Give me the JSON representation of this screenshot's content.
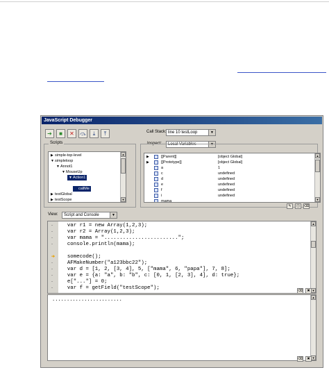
{
  "window": {
    "title": "JavaScript Debugger"
  },
  "toolbar": {
    "buttons": [
      {
        "name": "resume-button",
        "icon": "green-arrow-icon",
        "glyph": "➔",
        "color": "#2d8a2d"
      },
      {
        "name": "pause-button",
        "icon": "pause-icon",
        "glyph": "■",
        "color": "#2d8a2d"
      },
      {
        "name": "quit-button",
        "icon": "red-x-icon",
        "glyph": "✕",
        "color": "#c41a1a"
      },
      {
        "name": "step-over-button",
        "icon": "step-over-icon",
        "glyph": "⤼",
        "color": "#1e3a7a"
      },
      {
        "name": "step-into-button",
        "icon": "step-into-icon",
        "glyph": "⤓",
        "color": "#1e3a7a"
      },
      {
        "name": "step-out-button",
        "icon": "step-out-icon",
        "glyph": "⤒",
        "color": "#1e3a7a"
      }
    ]
  },
  "callstack": {
    "label": "Call Stack:",
    "value": "line 10 testLoop"
  },
  "inspect": {
    "label": "Inspect:",
    "value": "Local Variables"
  },
  "scripts": {
    "label": "Scripts",
    "tree": [
      {
        "label": "simple-top-level",
        "indent": 0,
        "expander": "▶"
      },
      {
        "label": "simpleloop",
        "indent": 0,
        "expander": "▼"
      },
      {
        "label": "Annot1",
        "indent": 1,
        "expander": "▼"
      },
      {
        "label": "MouseUp",
        "indent": 2,
        "expander": "▼"
      },
      {
        "label": "Action1",
        "indent": 3,
        "expander": "▼",
        "selected": true
      },
      {
        "label": "",
        "indent": 4,
        "expander": ""
      },
      {
        "label": "callMe",
        "indent": 4,
        "expander": "",
        "selected": true
      },
      {
        "label": "testGlobal",
        "indent": 0,
        "expander": "▶"
      },
      {
        "label": "testScope",
        "indent": 0,
        "expander": "▶"
      }
    ]
  },
  "variables": [
    {
      "name": "[[Parent]]",
      "value": "[object Global]",
      "expander": "▶"
    },
    {
      "name": "[[Prototype]]",
      "value": "[object Global]",
      "expander": "▶"
    },
    {
      "name": "a",
      "value": "1",
      "expander": ""
    },
    {
      "name": "c",
      "value": "undefined",
      "expander": ""
    },
    {
      "name": "d",
      "value": "undefined",
      "expander": ""
    },
    {
      "name": "e",
      "value": "undefined",
      "expander": ""
    },
    {
      "name": "f",
      "value": "undefined",
      "expander": ""
    },
    {
      "name": "i",
      "value": "undefined",
      "expander": ""
    },
    {
      "name": "mama",
      "value": "",
      "expander": ""
    }
  ],
  "view": {
    "label": "View:",
    "value": "Script and Console"
  },
  "code": [
    {
      "text": "  var r1 = new Array(1,2,3);",
      "marker": "-"
    },
    {
      "text": "  var r2 = Array(1,2,3);",
      "marker": "-"
    },
    {
      "text": "  var mama = \"........................\";",
      "marker": "-"
    },
    {
      "text": "  console.println(mama);",
      "marker": "-"
    },
    {
      "text": "",
      "marker": ""
    },
    {
      "text": "  somecode();",
      "marker": "➔",
      "breakpoint": true
    },
    {
      "text": "  AFMakeNumber(\"a123bbc22\");",
      "marker": "-"
    },
    {
      "text": "  var d = [1, 2, [3, 4], 5, [\"mama\", 6, \"papa\"], 7, 8];",
      "marker": "-"
    },
    {
      "text": "  var e = {a: \"a\", b: \"b\", c: [0, 1, [2, 3], 4], d: true};",
      "marker": "-"
    },
    {
      "text": "  e[\"...\"] = 0;",
      "marker": "-"
    },
    {
      "text": "  var f = getField(\"testScope\");",
      "marker": "-"
    }
  ],
  "console": {
    "output": "........................"
  }
}
